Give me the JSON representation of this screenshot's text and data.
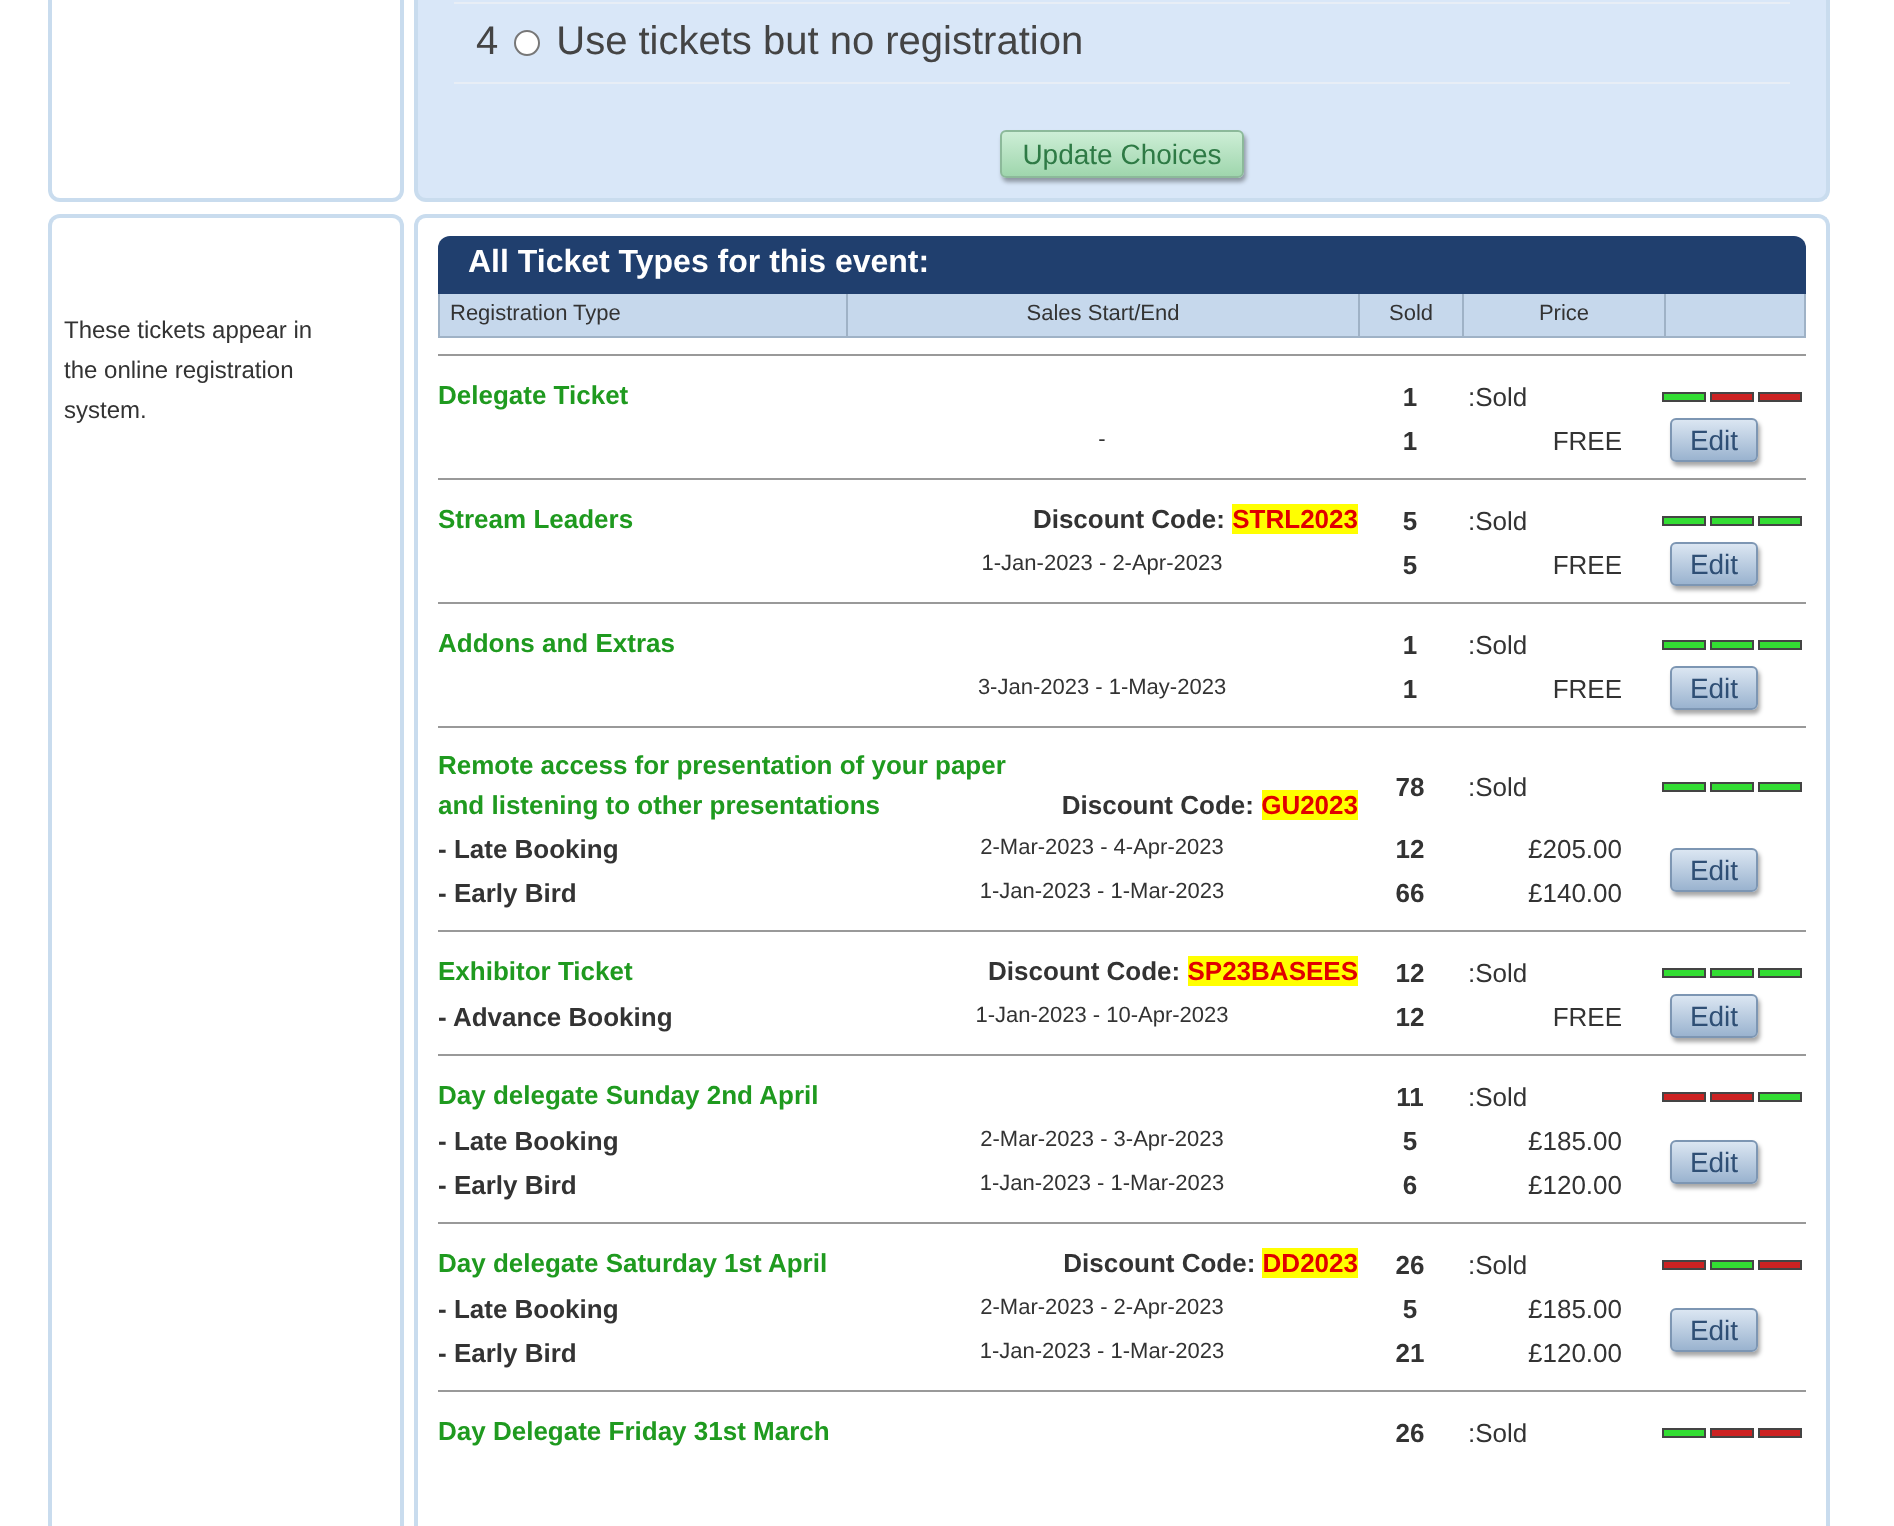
{
  "choice": {
    "number": "4",
    "selected": false,
    "label": "Use tickets but no registration"
  },
  "update_button": "Update Choices",
  "sidebar_note": "These tickets appear in the online registration system.",
  "tickets": {
    "title": "All Ticket Types for this event:",
    "columns": [
      "Registration Type",
      "Sales Start/End",
      "Sold",
      "Price"
    ],
    "groups": [
      {
        "name": "Delegate Ticket",
        "sold": "1",
        "sold_label": ":Sold",
        "indicators": [
          {
            "color": "#33dd33"
          },
          {
            "color": "#cc2222"
          },
          {
            "color": "#cc2222"
          }
        ],
        "rows": [
          {
            "dates": "-",
            "sold": "1",
            "price": "FREE"
          }
        ],
        "edit": "Edit"
      },
      {
        "name": "Stream Leaders",
        "discount": {
          "label": "Discount Code:",
          "code": "STRL2023"
        },
        "sold": "5",
        "sold_label": ":Sold",
        "indicators": [
          {
            "color": "#33dd33"
          },
          {
            "color": "#33dd33"
          },
          {
            "color": "#33dd33"
          }
        ],
        "rows": [
          {
            "dates": "1-Jan-2023 - 2-Apr-2023",
            "sold": "5",
            "price": "FREE"
          }
        ],
        "edit": "Edit"
      },
      {
        "name": "Addons and Extras",
        "sold": "1",
        "sold_label": ":Sold",
        "indicators": [
          {
            "color": "#33dd33"
          },
          {
            "color": "#33dd33"
          },
          {
            "color": "#33dd33"
          }
        ],
        "rows": [
          {
            "dates": "3-Jan-2023 - 1-May-2023",
            "sold": "1",
            "price": "FREE"
          }
        ],
        "edit": "Edit"
      },
      {
        "name": "Remote access for presentation of your paper and listening to other presentations",
        "discount": {
          "label": "Discount Code:",
          "code": "GU2023"
        },
        "sold": "78",
        "sold_label": ":Sold",
        "indicators": [
          {
            "color": "#33dd33"
          },
          {
            "color": "#33dd33"
          },
          {
            "color": "#33dd33"
          }
        ],
        "rows": [
          {
            "label": "- Late Booking",
            "dates": "2-Mar-2023 - 4-Apr-2023",
            "sold": "12",
            "price": "£205.00"
          },
          {
            "label": "- Early Bird",
            "dates": "1-Jan-2023 - 1-Mar-2023",
            "sold": "66",
            "price": "£140.00"
          }
        ],
        "edit": "Edit"
      },
      {
        "name": "Exhibitor Ticket",
        "discount": {
          "label": "Discount Code:",
          "code": "SP23BASEES"
        },
        "sold": "12",
        "sold_label": ":Sold",
        "indicators": [
          {
            "color": "#33dd33"
          },
          {
            "color": "#33dd33"
          },
          {
            "color": "#33dd33"
          }
        ],
        "rows": [
          {
            "label": "- Advance Booking",
            "dates": "1-Jan-2023 - 10-Apr-2023",
            "sold": "12",
            "price": "FREE"
          }
        ],
        "edit": "Edit"
      },
      {
        "name": "Day delegate Sunday 2nd April",
        "sold": "11",
        "sold_label": ":Sold",
        "indicators": [
          {
            "color": "#cc2222"
          },
          {
            "color": "#cc2222"
          },
          {
            "color": "#33dd33"
          }
        ],
        "rows": [
          {
            "label": "- Late Booking",
            "dates": "2-Mar-2023 - 3-Apr-2023",
            "sold": "5",
            "price": "£185.00"
          },
          {
            "label": "- Early Bird",
            "dates": "1-Jan-2023 - 1-Mar-2023",
            "sold": "6",
            "price": "£120.00"
          }
        ],
        "edit": "Edit"
      },
      {
        "name": "Day delegate Saturday 1st April",
        "discount": {
          "label": "Discount Code:",
          "code": "DD2023"
        },
        "sold": "26",
        "sold_label": ":Sold",
        "indicators": [
          {
            "color": "#cc2222"
          },
          {
            "color": "#33dd33"
          },
          {
            "color": "#cc2222"
          }
        ],
        "rows": [
          {
            "label": "- Late Booking",
            "dates": "2-Mar-2023 - 2-Apr-2023",
            "sold": "5",
            "price": "£185.00"
          },
          {
            "label": "- Early Bird",
            "dates": "1-Jan-2023 - 1-Mar-2023",
            "sold": "21",
            "price": "£120.00"
          }
        ],
        "edit": "Edit"
      },
      {
        "name": "Day Delegate Friday 31st March",
        "sold": "26",
        "sold_label": ":Sold",
        "indicators": [
          {
            "color": "#33dd33"
          },
          {
            "color": "#cc2222"
          },
          {
            "color": "#cc2222"
          }
        ]
      }
    ]
  }
}
